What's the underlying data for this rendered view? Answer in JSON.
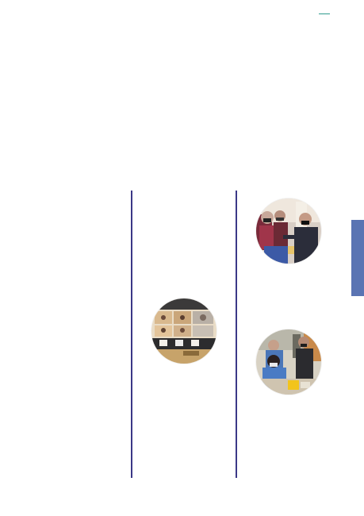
{
  "colors": {
    "accent_teal": "#2f9b8e",
    "divider": "#3b3887",
    "side_tab": "#5a74b3"
  },
  "images": [
    {
      "name": "photo-group-greeting"
    },
    {
      "name": "photo-video-conference"
    },
    {
      "name": "photo-vaccination"
    }
  ]
}
